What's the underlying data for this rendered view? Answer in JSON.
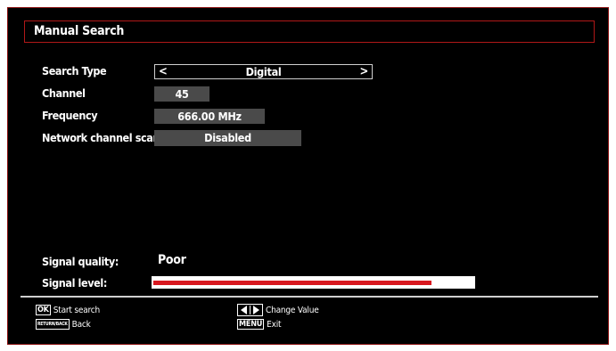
{
  "menu": {
    "title": "Manual Search"
  },
  "rows": {
    "search_type": {
      "label": "Search Type",
      "value": "Digital"
    },
    "channel": {
      "label": "Channel",
      "value": "45"
    },
    "frequency": {
      "label": "Frequency",
      "value": "666.00 MHz"
    },
    "network_scan": {
      "label": "Network channel scan",
      "value": "Disabled"
    }
  },
  "signal": {
    "quality_label": "Signal quality:",
    "quality_value": "Poor",
    "level_label": "Signal level:",
    "level_fraction": 0.87
  },
  "legend": {
    "ok_key": "OK",
    "ok_action": "Start search",
    "return_key": "RETURN/BACK",
    "return_action": "Back",
    "arrows_action": "Change Value",
    "menu_key": "MENU",
    "menu_action": "Exit"
  },
  "colors": {
    "frame_border": "#b01818",
    "level_fill": "#d81820",
    "level_track": "#ffffff",
    "field_bg": "#4a4a4a"
  }
}
